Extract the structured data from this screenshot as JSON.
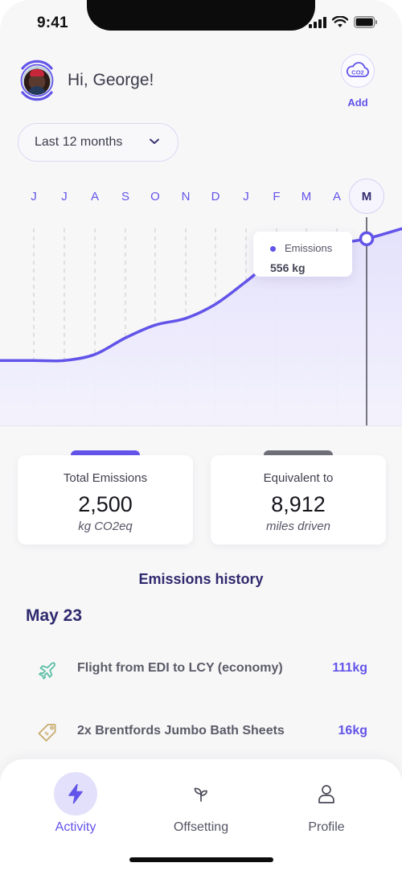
{
  "status_bar": {
    "time": "9:41"
  },
  "header": {
    "greeting": "Hi, George!",
    "add_label": "Add",
    "co2_icon_text": "CO2"
  },
  "filter": {
    "selected": "Last 12 months"
  },
  "months": [
    "J",
    "J",
    "A",
    "S",
    "O",
    "N",
    "D",
    "J",
    "F",
    "M",
    "A",
    "M"
  ],
  "active_month_index": 11,
  "colors": {
    "accent": "#6254e8",
    "accent_fill": "#ebe8fc",
    "dark_text": "#2f2a6e",
    "grey_tab": "#6e6e78"
  },
  "chart_data": {
    "type": "area",
    "x": [
      "J",
      "J",
      "A",
      "S",
      "O",
      "N",
      "D",
      "J",
      "F",
      "M",
      "A",
      "M"
    ],
    "series": [
      {
        "name": "Emissions",
        "values": [
          195,
          195,
          213,
          262,
          300,
          320,
          362,
          429,
          499,
          527,
          542,
          556
        ]
      }
    ],
    "ylim": [
      0,
      620
    ],
    "grid": "vertical dashed",
    "tooltip": {
      "label": "Emissions",
      "value": "556 kg"
    }
  },
  "summary": [
    {
      "title": "Total Emissions",
      "value": "2,500",
      "unit": "kg CO2eq"
    },
    {
      "title": "Equivalent to",
      "value": "8,912",
      "unit": "miles driven"
    }
  ],
  "history": {
    "title": "Emissions history",
    "group": "May 23",
    "items": [
      {
        "icon": "plane-icon",
        "name": "Flight from EDI to LCY (economy)",
        "amount": "111kg"
      },
      {
        "icon": "price-tag-icon",
        "name": "2x Brentfords Jumbo Bath Sheets",
        "amount": "16kg"
      }
    ]
  },
  "nav": {
    "items": [
      {
        "label": "Activity",
        "icon": "lightning-icon",
        "active": true
      },
      {
        "label": "Offsetting",
        "icon": "sprout-icon",
        "active": false
      },
      {
        "label": "Profile",
        "icon": "user-icon",
        "active": false
      }
    ]
  }
}
